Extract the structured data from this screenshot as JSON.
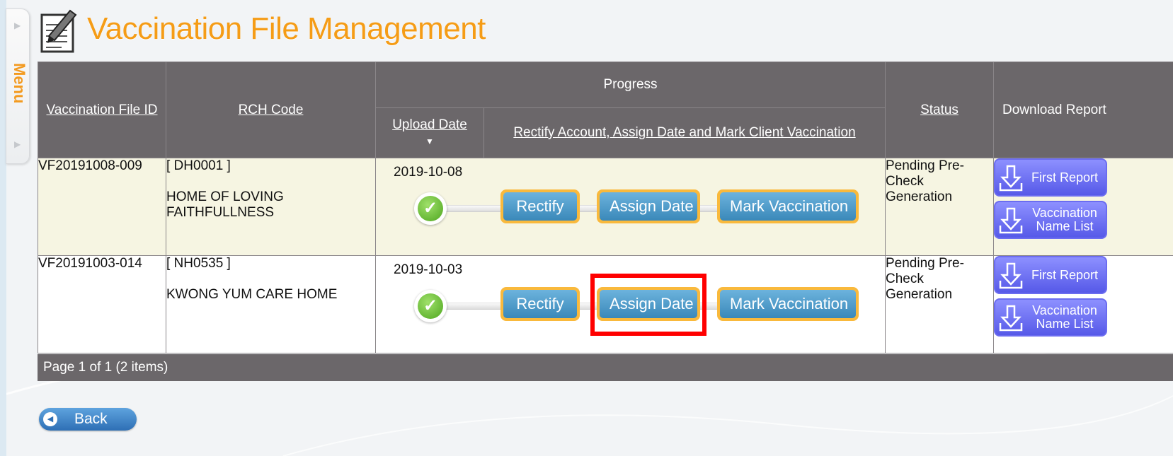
{
  "side_menu": {
    "label": "Menu"
  },
  "page": {
    "title": "Vaccination File Management"
  },
  "table": {
    "headers": {
      "file_id": "Vaccination File ID",
      "rch_code": "RCH Code",
      "progress": "Progress",
      "upload_date": "Upload Date",
      "rectify_group": "Rectify Account, Assign Date and Mark Client Vaccination",
      "status": "Status",
      "download_report": "Download Report"
    },
    "rows": [
      {
        "file_id": "VF20191008-009",
        "rch_code": "[ DH0001 ]",
        "rch_name": "HOME OF LOVING FAITHFULLNESS",
        "upload_date": "2019-10-08",
        "rectify_label": "Rectify",
        "assign_label": "Assign Date",
        "mark_label": "Mark Vaccination",
        "status": "Pending Pre-Check Generation",
        "first_report": "First Report",
        "name_list": "Vaccination Name List"
      },
      {
        "file_id": "VF20191003-014",
        "rch_code": "[ NH0535 ]",
        "rch_name": "KWONG YUM CARE HOME",
        "upload_date": "2019-10-03",
        "rectify_label": "Rectify",
        "assign_label": "Assign Date",
        "mark_label": "Mark Vaccination",
        "status": "Pending Pre-Check Generation",
        "first_report": "First Report",
        "name_list": "Vaccination Name List"
      }
    ]
  },
  "pager": {
    "text": "Page 1 of 1 (2 items)"
  },
  "back_button": {
    "label": "Back"
  },
  "icons": {
    "title": "document-pen-icon",
    "step_done": "check-circle-icon",
    "download": "download-arrow-icon",
    "back": "chevron-left-icon",
    "sort": "sort-desc-icon"
  },
  "colors": {
    "title": "#f59c16",
    "header_bg": "#6b676a",
    "row_alt_bg": "#f6f5e2",
    "step_border": "#f9b93c",
    "step_fill": "#3a88b9",
    "download_btn": "#5659e8",
    "highlight": "#ff0000"
  }
}
